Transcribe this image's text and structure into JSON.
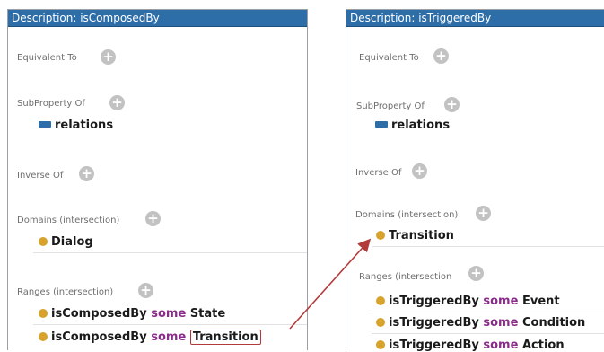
{
  "left": {
    "header": "Description: isComposedBy",
    "equivalent_label": "Equivalent To",
    "subproperty_label": "SubProperty Of",
    "subproperty_value": "relations",
    "inverse_label": "Inverse Of",
    "domains_label": "Domains (intersection)",
    "domain_value": "Dialog",
    "ranges_label": "Ranges (intersection)",
    "ranges": [
      {
        "prop": "isComposedBy",
        "kw": "some",
        "cls": "State"
      },
      {
        "prop": "isComposedBy",
        "kw": "some",
        "cls": "Transition"
      }
    ]
  },
  "right": {
    "header": "Description: isTriggeredBy",
    "equivalent_label": "Equivalent To",
    "subproperty_label": "SubProperty Of",
    "subproperty_value": "relations",
    "inverse_label": "Inverse Of",
    "domains_label": "Domains (intersection)",
    "domain_value": "Transition",
    "ranges_label": "Ranges (intersection",
    "ranges": [
      {
        "prop": "isTriggeredBy",
        "kw": "some",
        "cls": "Event"
      },
      {
        "prop": "isTriggeredBy",
        "kw": "some",
        "cls": "Condition"
      },
      {
        "prop": "isTriggeredBy",
        "kw": "some",
        "cls": "Action"
      }
    ]
  },
  "plus_symbol": "+",
  "colors": {
    "header": "#2d6da8",
    "keyword": "#8b2c8b",
    "class_dot": "#d8a32c",
    "arrow": "#b33a3a"
  }
}
